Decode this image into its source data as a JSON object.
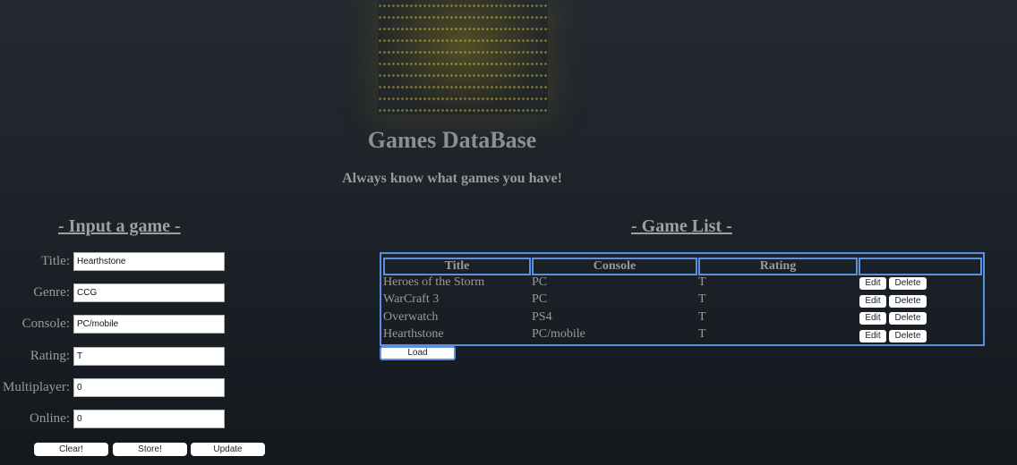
{
  "header": {
    "title": "Games DataBase",
    "subtitle": "Always know what games you have!"
  },
  "input_section": {
    "heading": "- Input a game -",
    "fields": [
      {
        "label": "Title:",
        "value": "Hearthstone"
      },
      {
        "label": "Genre:",
        "value": "CCG"
      },
      {
        "label": "Console:",
        "value": "PC/mobile"
      },
      {
        "label": "Rating:",
        "value": "T"
      },
      {
        "label": "Multiplayer:",
        "value": "0"
      },
      {
        "label": "Online:",
        "value": "0"
      }
    ],
    "buttons": {
      "clear": "Clear!",
      "store": "Store!",
      "update": "Update"
    }
  },
  "list_section": {
    "heading": "- Game List -",
    "columns": [
      "Title",
      "Console",
      "Rating",
      ""
    ],
    "rows": [
      {
        "title": "Heroes of the Storm",
        "console": "PC",
        "rating": "T",
        "edit": "Edit",
        "delete": "Delete"
      },
      {
        "title": "WarCraft 3",
        "console": "PC",
        "rating": "T",
        "edit": "Edit",
        "delete": "Delete"
      },
      {
        "title": "Overwatch",
        "console": "PS4",
        "rating": "T",
        "edit": "Edit",
        "delete": "Delete"
      },
      {
        "title": "Hearthstone",
        "console": "PC/mobile",
        "rating": "T",
        "edit": "Edit",
        "delete": "Delete"
      }
    ],
    "load_label": "Load"
  },
  "colors": {
    "table_border": "#5b8fe0",
    "text": "#9a9a9a",
    "background": "#1c2228"
  }
}
